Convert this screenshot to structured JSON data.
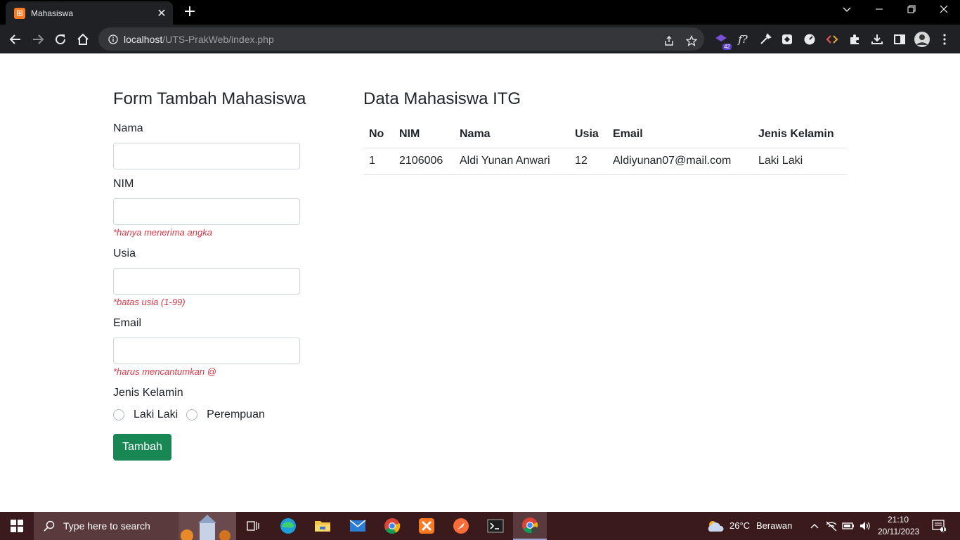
{
  "browser": {
    "tab_title": "Mahasiswa",
    "tab_favicon_glyph": "⊞",
    "url_host": "localhost",
    "url_path": "/UTS-PrakWeb/index.php",
    "extension_badge": "42",
    "extension_f_label": "f?"
  },
  "form": {
    "title": "Form Tambah Mahasiswa",
    "nama_label": "Nama",
    "nim_label": "NIM",
    "nim_hint": "*hanya menerima angka",
    "usia_label": "Usia",
    "usia_hint": "*batas usia (1-99)",
    "email_label": "Email",
    "email_hint": "*harus mencantumkan @",
    "gender_label": "Jenis Kelamin",
    "gender_options": [
      "Laki Laki",
      "Perempuan"
    ],
    "submit_label": "Tambah"
  },
  "table": {
    "title": "Data Mahasiswa ITG",
    "headers": [
      "No",
      "NIM",
      "Nama",
      "Usia",
      "Email",
      "Jenis Kelamin"
    ],
    "rows": [
      [
        "1",
        "2106006",
        "Aldi Yunan Anwari",
        "12",
        "Aldiyunan07@mail.com",
        "Laki Laki"
      ]
    ]
  },
  "taskbar": {
    "search_placeholder": "Type here to search",
    "weather_temp": "26°C",
    "weather_desc": "Berawan",
    "time": "21:10",
    "date": "20/11/2023",
    "notification_count": "1"
  },
  "colors": {
    "accent_green": "#198754",
    "hint_red": "#dc3545",
    "taskbar_bg": "#3b1a1c"
  }
}
